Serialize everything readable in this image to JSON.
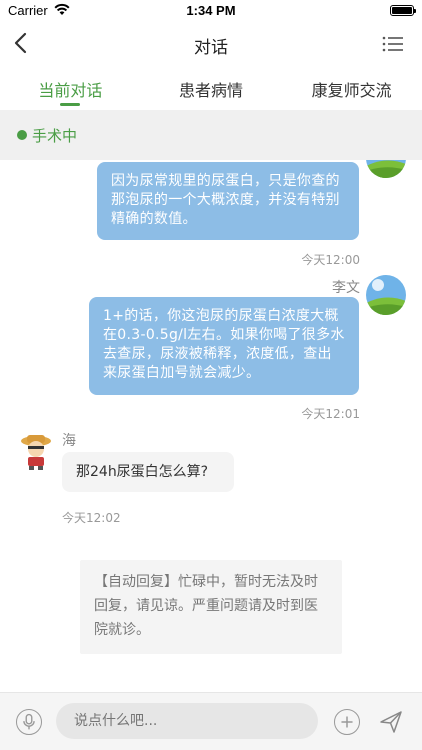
{
  "status_bar": {
    "carrier": "Carrier",
    "time": "1:34 PM"
  },
  "nav": {
    "title": "对话"
  },
  "tabs": [
    {
      "label": "当前对话",
      "active": true
    },
    {
      "label": "患者病情",
      "active": false
    },
    {
      "label": "康复师交流",
      "active": false
    }
  ],
  "status": {
    "label": "手术中"
  },
  "messages": [
    {
      "dir": "out",
      "text": "因为尿常规里的尿蛋白，只是你查的那泡尿的一个大概浓度，并没有特别精确的数值。",
      "time": "今天12:00"
    },
    {
      "dir": "out",
      "sender": "李文",
      "text": "1+的话，你这泡尿的尿蛋白浓度大概在0.3-0.5g/l左右。如果你喝了很多水去查尿，尿液被稀释，浓度低，查出来尿蛋白加号就会减少。",
      "time": "今天12:01"
    },
    {
      "dir": "in",
      "sender": "海",
      "text": "那24h尿蛋白怎么算?",
      "time": "今天12:02"
    }
  ],
  "auto_reply": "【自动回复】忙碌中，暂时无法及时回复，请见谅。严重问题请及时到医院就诊。",
  "input": {
    "placeholder": "说点什么吧..."
  },
  "colors": {
    "accent": "#4a9d45",
    "bubble_out": "#8dbde6",
    "status_bg": "#f0f0f0"
  }
}
